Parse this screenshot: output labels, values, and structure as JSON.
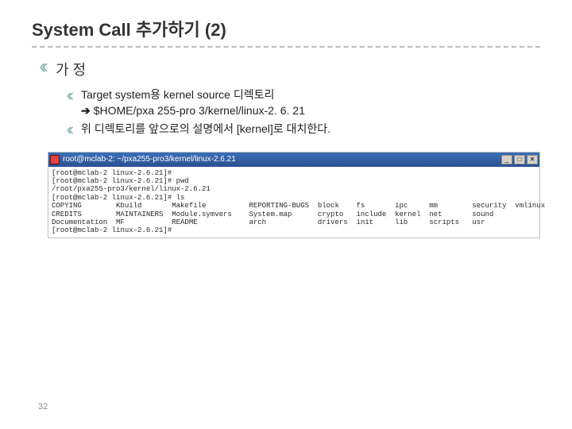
{
  "title": "System Call 추가하기 (2)",
  "level1_text": "가 정",
  "bullets": [
    {
      "line1": "Target system용 kernel source 디렉토리",
      "arrow": "➔",
      "line2": "$HOME/pxa 255-pro 3/kernel/linux-2. 6. 21"
    },
    {
      "line1": "위 디렉토리를 앞으로의 설명에서 [kernel]로 대치한다."
    }
  ],
  "terminal": {
    "title": "root@mclab-2: ~/pxa255-pro3/kernel/linux-2.6.21",
    "lines": [
      "[root@mclab-2 linux-2.6.21]#",
      "[root@mclab-2 linux-2.6.21]# pwd",
      "/root/pxa255-pro3/kernel/linux-2.6.21",
      "[root@mclab-2 linux-2.6.21]# ls",
      "COPYING        Kbuild       Makefile          REPORTING-BUGS  block    fs       ipc     mm        security  vmlinux",
      "CREDITS        MAINTAINERS  Module.symvers    System.map      crypto   include  kernel  net       sound",
      "Documentation  MF           README            arch            drivers  init     lib     scripts   usr",
      "[root@mclab-2 linux-2.6.21]# "
    ]
  },
  "win_btns": {
    "min": "_",
    "max": "□",
    "close": "✕"
  },
  "page_number": "32"
}
